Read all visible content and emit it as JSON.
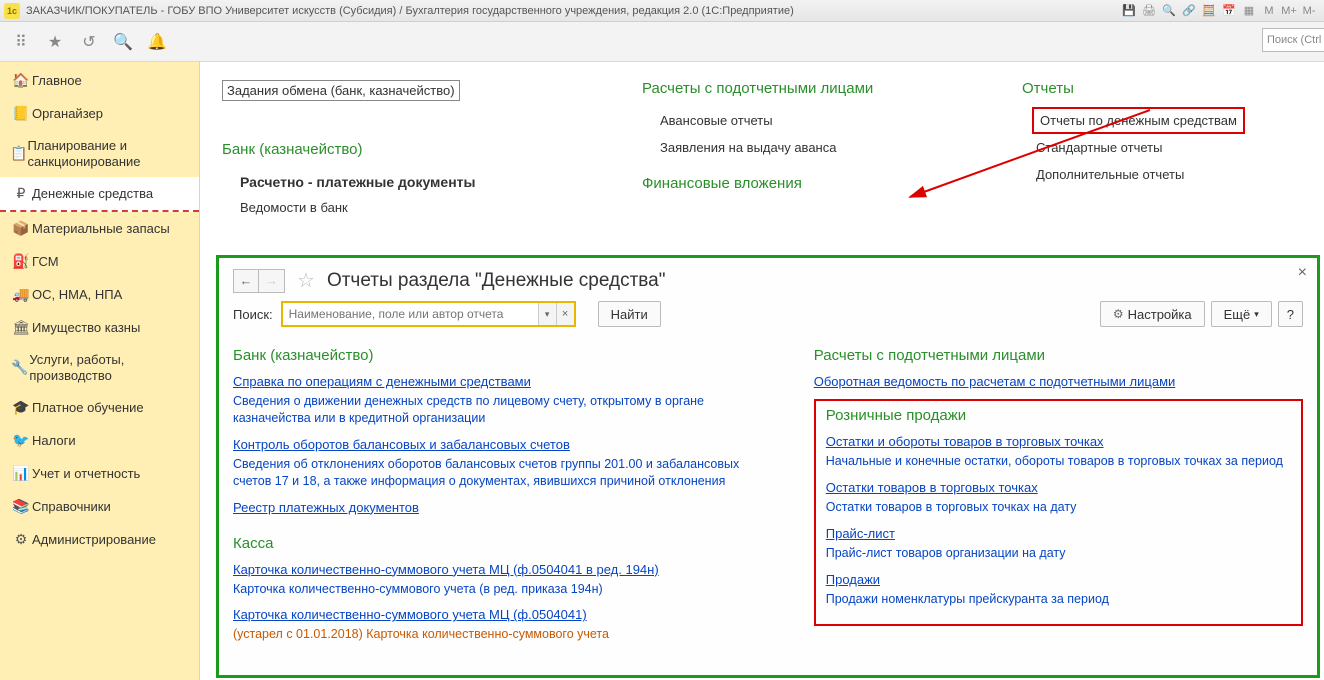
{
  "window_title": "ЗАКАЗЧИК/ПОКУПАТЕЛЬ - ГОБУ ВПО Университет искусств (Субсидия) / Бухгалтерия государственного учреждения, редакция 2.0  (1С:Предприятие)",
  "top_search_placeholder": "Поиск (Ctrl",
  "sidebar": [
    {
      "label": "Главное",
      "icon": "🏠"
    },
    {
      "label": "Органайзер",
      "icon": "📒"
    },
    {
      "label": "Планирование и санкционирование",
      "icon": "📋",
      "multiline": true
    },
    {
      "label": "Денежные средства",
      "icon": "₽",
      "active": true
    },
    {
      "label": "Материальные запасы",
      "icon": "📦"
    },
    {
      "label": "ГСМ",
      "icon": "⛽"
    },
    {
      "label": "ОС, НМА, НПА",
      "icon": "🚚"
    },
    {
      "label": "Имущество казны",
      "icon": "🏛"
    },
    {
      "label": "Услуги, работы, производство",
      "icon": "🔧",
      "multiline": true
    },
    {
      "label": "Платное обучение",
      "icon": "🎓"
    },
    {
      "label": "Налоги",
      "icon": "🐦"
    },
    {
      "label": "Учет и отчетность",
      "icon": "📊"
    },
    {
      "label": "Справочники",
      "icon": "📚"
    },
    {
      "label": "Администрирование",
      "icon": "⚙"
    }
  ],
  "upper": {
    "c1_boxed": "Задания обмена (банк, казначейство)",
    "c1_head": "Банк (казначейство)",
    "c1_sub": "Расчетно - платежные документы",
    "c1_l2": "Ведомости в банк",
    "c2_head": "Расчеты с подотчетными лицами",
    "c2_l1": "Авансовые отчеты",
    "c2_l2": "Заявления на выдачу аванса",
    "c2_head2": "Финансовые вложения",
    "c3_head": "Отчеты",
    "c3_l1": "Отчеты по денежным средствам",
    "c3_l2": "Стандартные отчеты",
    "c3_l3": "Дополнительные отчеты"
  },
  "panel": {
    "title": "Отчеты раздела \"Денежные средства\"",
    "search_label": "Поиск:",
    "search_placeholder": "Наименование, поле или автор отчета",
    "find_btn": "Найти",
    "settings_btn": "Настройка",
    "more_btn": "Ещё",
    "left": {
      "sec1": "Банк (казначейство)",
      "r1": "Справка по операциям с денежными средствами",
      "r1d": "Сведения о движении денежных средств по лицевому счету, открытому в органе казначейства или в кредитной организации",
      "r2": "Контроль оборотов балансовых и забалансовых счетов",
      "r2d": "Сведения об отклонениях оборотов балансовых счетов группы 201.00 и забалансовых счетов 17 и 18, а также информация о документах, явившихся причиной отклонения",
      "r3": "Реестр платежных документов",
      "sec2": "Касса",
      "r4": "Карточка количественно-суммового учета МЦ  (ф.0504041 в ред. 194н)",
      "r4d": "Карточка количественно-суммового учета (в ред. приказа 194н)",
      "r5": "Карточка количественно-суммового учета МЦ  (ф.0504041)",
      "r5d": "(устарел с 01.01.2018) Карточка количественно-суммового учета"
    },
    "right": {
      "sec1": "Расчеты с подотчетными лицами",
      "r1": "Оборотная ведомость по расчетам с подотчетными лицами",
      "sec2": "Розничные продажи",
      "b1": "Остатки и обороты товаров в торговых точках",
      "b1d": "Начальные и конечные остатки, обороты товаров в торговых точках за период",
      "b2": "Остатки товаров в торговых точках",
      "b2d": "Остатки товаров в торговых точках на дату",
      "b3": "Прайс-лист",
      "b3d": "Прайс-лист товаров организации на дату",
      "b4": "Продажи",
      "b4d": "Продажи номенклатуры прейскуранта за период"
    }
  }
}
